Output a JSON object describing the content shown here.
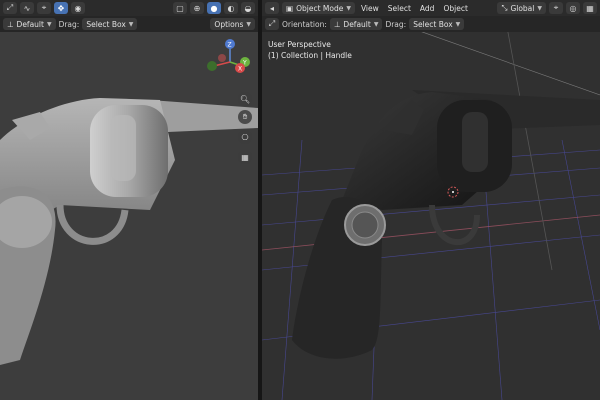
{
  "left_viewport": {
    "transform_orientation": "Default",
    "drag_label": "Drag:",
    "drag_mode": "Select Box",
    "options_label": "Options",
    "gizmo_axes": {
      "z": "Z",
      "y": "Y",
      "x": "X"
    }
  },
  "right_viewport": {
    "mode": "Object Mode",
    "menus": [
      "View",
      "Select",
      "Add",
      "Object"
    ],
    "transform_global": "Global",
    "orientation_label": "Orientation:",
    "orientation_value": "Default",
    "drag_label": "Drag:",
    "drag_mode": "Select Box",
    "view_name": "User Perspective",
    "collection_info": "(1) Collection | Handle"
  },
  "colors": {
    "active_button": "#4772b3",
    "solid_background": "#3d3d3d",
    "render_background": "#303030",
    "model_solid": "#9a9a9a",
    "model_render": "#262626",
    "grid_blue": "#5a5adf",
    "grid_red": "#b45a6e"
  },
  "icons": {
    "left_toolbar": [
      "transform-icon",
      "curve-icon",
      "snap-icon",
      "move-arrows-icon",
      "overlay-icon",
      "xray-icon",
      "wireframe-shading-icon",
      "solid-shading-icon",
      "material-shading-icon",
      "rendered-shading-icon"
    ],
    "right_toolbar": [
      "mode-icon",
      "transform-orientation-icon",
      "snap-icon",
      "proportional-icon",
      "grid-icon"
    ],
    "navigation": [
      "zoom-icon",
      "hand-pan-icon",
      "camera-icon",
      "grid-view-icon"
    ]
  }
}
